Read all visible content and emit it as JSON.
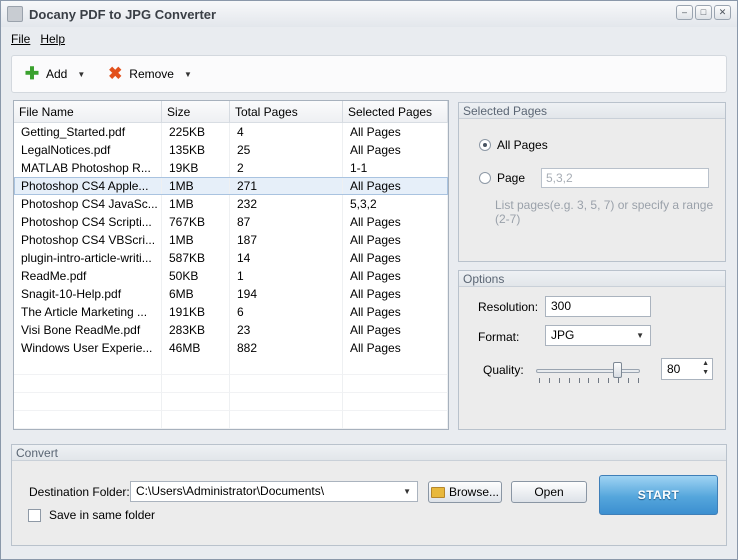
{
  "window": {
    "title": "Docany PDF to JPG Converter",
    "controls": {
      "minimize": "–",
      "maximize": "□",
      "close": "✕"
    }
  },
  "menu": {
    "file": "File",
    "help": "Help"
  },
  "toolbar": {
    "add_label": "Add",
    "remove_label": "Remove"
  },
  "file_list": {
    "columns": [
      "File Name",
      "Size",
      "Total Pages",
      "Selected Pages"
    ],
    "rows": [
      {
        "name": "Getting_Started.pdf",
        "size": "225KB",
        "pages": "4",
        "selected": "All Pages"
      },
      {
        "name": "LegalNotices.pdf",
        "size": "135KB",
        "pages": "25",
        "selected": "All Pages"
      },
      {
        "name": "MATLAB Photoshop R...",
        "size": "19KB",
        "pages": "2",
        "selected": "1-1"
      },
      {
        "name": "Photoshop CS4 Apple...",
        "size": "1MB",
        "pages": "271",
        "selected": "All Pages"
      },
      {
        "name": "Photoshop CS4 JavaSc...",
        "size": "1MB",
        "pages": "232",
        "selected": "5,3,2"
      },
      {
        "name": "Photoshop CS4 Scripti...",
        "size": "767KB",
        "pages": "87",
        "selected": "All Pages"
      },
      {
        "name": "Photoshop CS4 VBScri...",
        "size": "1MB",
        "pages": "187",
        "selected": "All Pages"
      },
      {
        "name": "plugin-intro-article-writi...",
        "size": "587KB",
        "pages": "14",
        "selected": "All Pages"
      },
      {
        "name": "ReadMe.pdf",
        "size": "50KB",
        "pages": "1",
        "selected": "All Pages"
      },
      {
        "name": "Snagit-10-Help.pdf",
        "size": "6MB",
        "pages": "194",
        "selected": "All Pages"
      },
      {
        "name": "The Article Marketing ...",
        "size": "191KB",
        "pages": "6",
        "selected": "All Pages"
      },
      {
        "name": "Visi Bone ReadMe.pdf",
        "size": "283KB",
        "pages": "23",
        "selected": "All Pages"
      },
      {
        "name": "Windows User Experie...",
        "size": "46MB",
        "pages": "882",
        "selected": "All Pages"
      }
    ]
  },
  "selected_pages": {
    "title": "Selected Pages",
    "all_pages_label": "All Pages",
    "page_label": "Page",
    "page_placeholder": "5,3,2",
    "hint": "List pages(e.g. 3, 5, 7)  or specify a  range (2-7)"
  },
  "options": {
    "title": "Options",
    "resolution_label": "Resolution:",
    "resolution_value": "300",
    "format_label": "Format:",
    "format_value": "JPG",
    "quality_label": "Quality:",
    "quality_value": "80",
    "spin_up": "▲",
    "spin_down": "▼"
  },
  "convert": {
    "title": "Convert",
    "destination_label": "Destination Folder:",
    "destination_value": "C:\\Users\\Administrator\\Documents\\",
    "browse_label": "Browse...",
    "open_label": "Open",
    "save_same_label": "Save in same folder",
    "start_label": "START"
  }
}
